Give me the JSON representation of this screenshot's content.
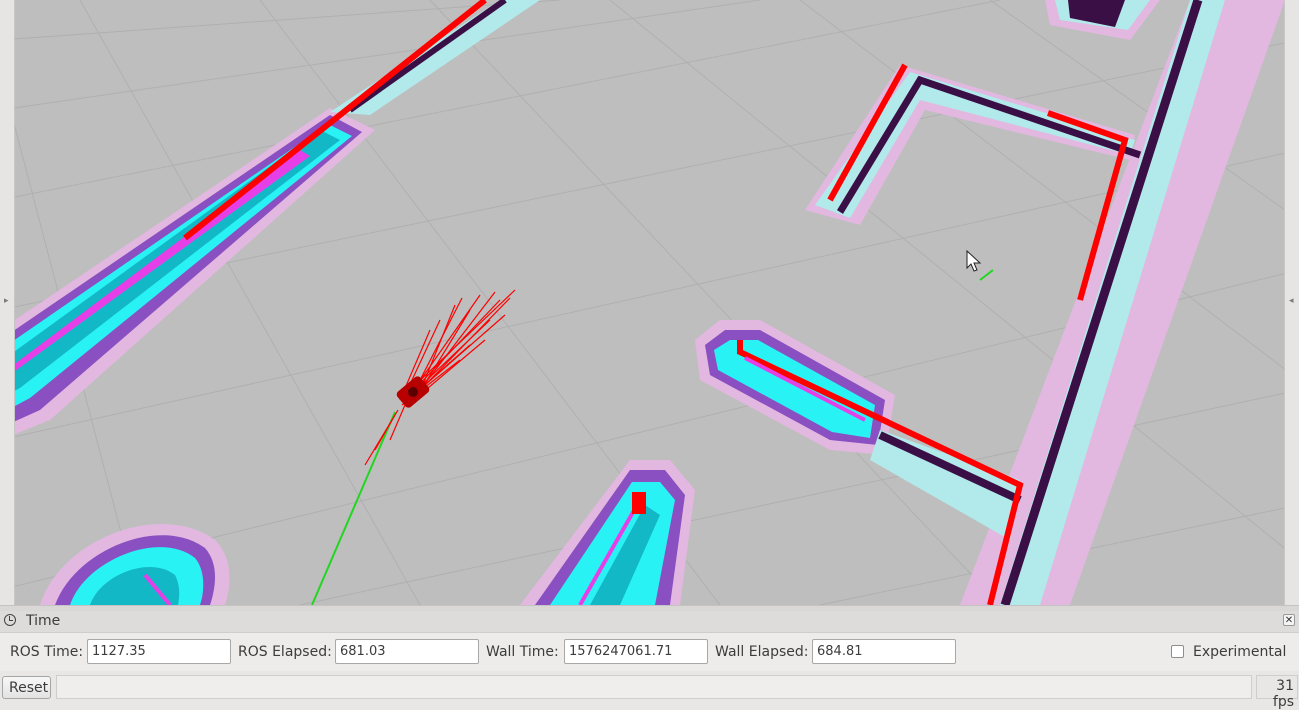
{
  "viewport": {
    "name": "3d-map-view",
    "cursor_icon": "mouse-pointer-icon",
    "robot_icon": "robot-model-icon"
  },
  "colors": {
    "floor": "#bebebe",
    "grid": "#b0b0b0",
    "obstacle": "#3a0f46",
    "inflation_light": "#b2e9ea",
    "inflation_cyan": "#29f2f4",
    "inflation_teal": "#13b8c6",
    "inflation_purple": "#8a4fc0",
    "inflation_pink": "#e2b8e0",
    "laser": "#ff0000",
    "path": "#21d621",
    "magenta": "#e63fe8"
  },
  "time_panel": {
    "title": "Time",
    "icon": "clock-icon",
    "close_icon": "close-icon",
    "ros_time_label": "ROS Time:",
    "ros_time_value": "1127.35",
    "ros_elapsed_label": "ROS Elapsed:",
    "ros_elapsed_value": "681.03",
    "wall_time_label": "Wall Time:",
    "wall_time_value": "1576247061.71",
    "wall_elapsed_label": "Wall Elapsed:",
    "wall_elapsed_value": "684.81",
    "experimental_label": "Experimental"
  },
  "status": {
    "reset_label": "Reset",
    "fps": "31 fps"
  }
}
